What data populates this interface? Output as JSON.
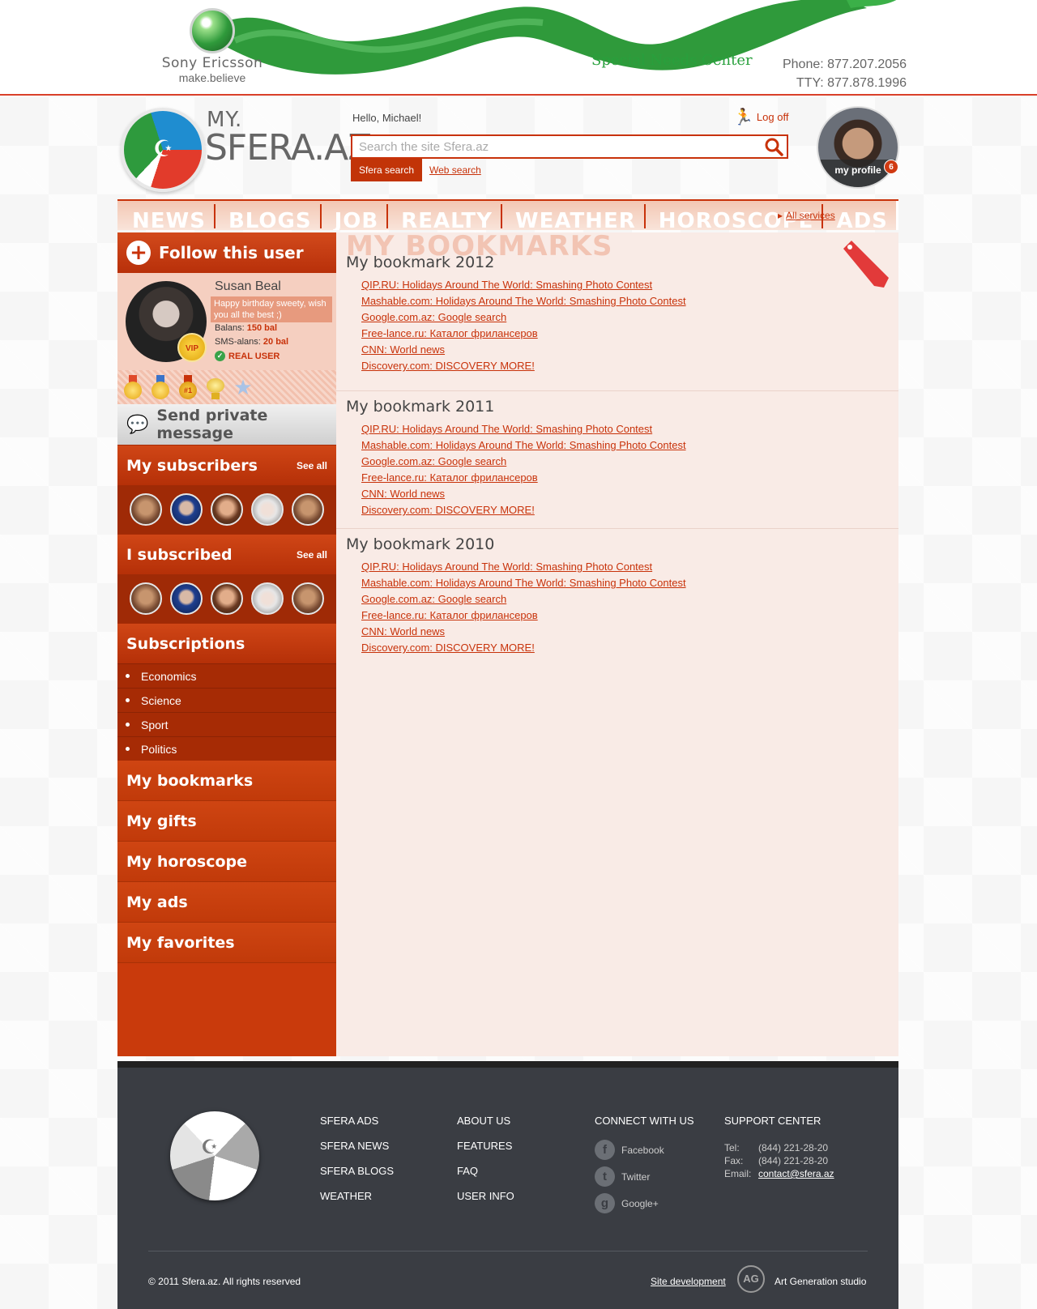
{
  "banner": {
    "brand": "Sony Ericsson",
    "slogan": "make.believe",
    "special_needs": "Special Needs Center",
    "phone": "Phone: 877.207.2056",
    "tty": "TTY: 877.878.1996"
  },
  "header": {
    "logo_my": "MY.",
    "logo_sfera": "SFERA.AZ",
    "greeting": "Hello, Michael!",
    "logoff": "Log off",
    "search_placeholder": "Search the site Sfera.az",
    "search_tab_active": "Sfera search",
    "search_tab_web": "Web search",
    "profile_label": "my profile",
    "profile_badge": "6"
  },
  "nav": {
    "items": [
      "NEWS",
      "BLOGS",
      "JOB",
      "REALTY",
      "WEATHER",
      "HOROSCOPE",
      "ADS"
    ],
    "all_services": "All services"
  },
  "sidebar": {
    "follow": "Follow this user",
    "user": {
      "name": "Susan Beal",
      "wish": "Happy birthday sweety, wish you all the best ;)",
      "balans_label": "Balans:",
      "balans_value": "150 bal",
      "sms_label": "SMS-alans:",
      "sms_value": "20 bal",
      "real": "REAL USER",
      "vip": "VIP"
    },
    "send_message": "Send private message",
    "subscribers": {
      "title": "My subscribers",
      "see_all": "See all"
    },
    "subscribed": {
      "title": "I subscribed",
      "see_all": "See all"
    },
    "subscriptions": {
      "title": "Subscriptions",
      "items": [
        "Economics",
        "Science",
        "Sport",
        "Politics"
      ]
    },
    "links": [
      "My bookmarks",
      "My gifts",
      "My horoscope",
      "My ads",
      "My favorites"
    ]
  },
  "main": {
    "title": "MY BOOKMARKS",
    "groups": [
      {
        "title": "My bookmark 2012",
        "links": [
          "QIP.RU: Holidays Around The World: Smashing Photo Contest",
          "Mashable.com: Holidays Around The World: Smashing Photo Contest",
          "Google.com.az: Google search",
          "Free-lance.ru: Каталог фрилансеров",
          "CNN: World news",
          "Discovery.com: DISCOVERY MORE!"
        ]
      },
      {
        "title": "My bookmark 2011",
        "links": [
          "QIP.RU: Holidays Around The World: Smashing Photo Contest",
          "Mashable.com: Holidays Around The World: Smashing Photo Contest",
          "Google.com.az: Google search",
          "Free-lance.ru: Каталог фрилансеров",
          "CNN: World news",
          "Discovery.com: DISCOVERY MORE!"
        ]
      },
      {
        "title": "My bookmark 2010",
        "links": [
          "QIP.RU: Holidays Around The World: Smashing Photo Contest",
          "Mashable.com: Holidays Around The World: Smashing Photo Contest",
          "Google.com.az: Google search",
          "Free-lance.ru: Каталог фрилансеров",
          "CNN: World news",
          "Discovery.com: DISCOVERY MORE!"
        ]
      }
    ]
  },
  "footer": {
    "col1": [
      "SFERA ADS",
      "SFERA NEWS",
      "SFERA BLOGS",
      "WEATHER"
    ],
    "col2": [
      "ABOUT US",
      "FEATURES",
      "FAQ",
      "USER INFO"
    ],
    "connect": {
      "title": "CONNECT WITH US",
      "items": [
        "Facebook",
        "Twitter",
        "Google+"
      ]
    },
    "support": {
      "title": "SUPPORT CENTER",
      "tel_label": "Tel:",
      "tel": "(844) 221-28-20",
      "fax_label": "Fax:",
      "fax": "(844) 221-28-20",
      "email_label": "Email:",
      "email": "contact@sfera.az"
    },
    "copyright": "© 2011 Sfera.az. All rights reserved",
    "site_dev": "Site development",
    "studio": "Art Generation studio"
  },
  "colors": {
    "accent": "#c8320a",
    "sidebar": "#c93a0c",
    "footer": "#3a3d43",
    "green": "#28a03c"
  }
}
